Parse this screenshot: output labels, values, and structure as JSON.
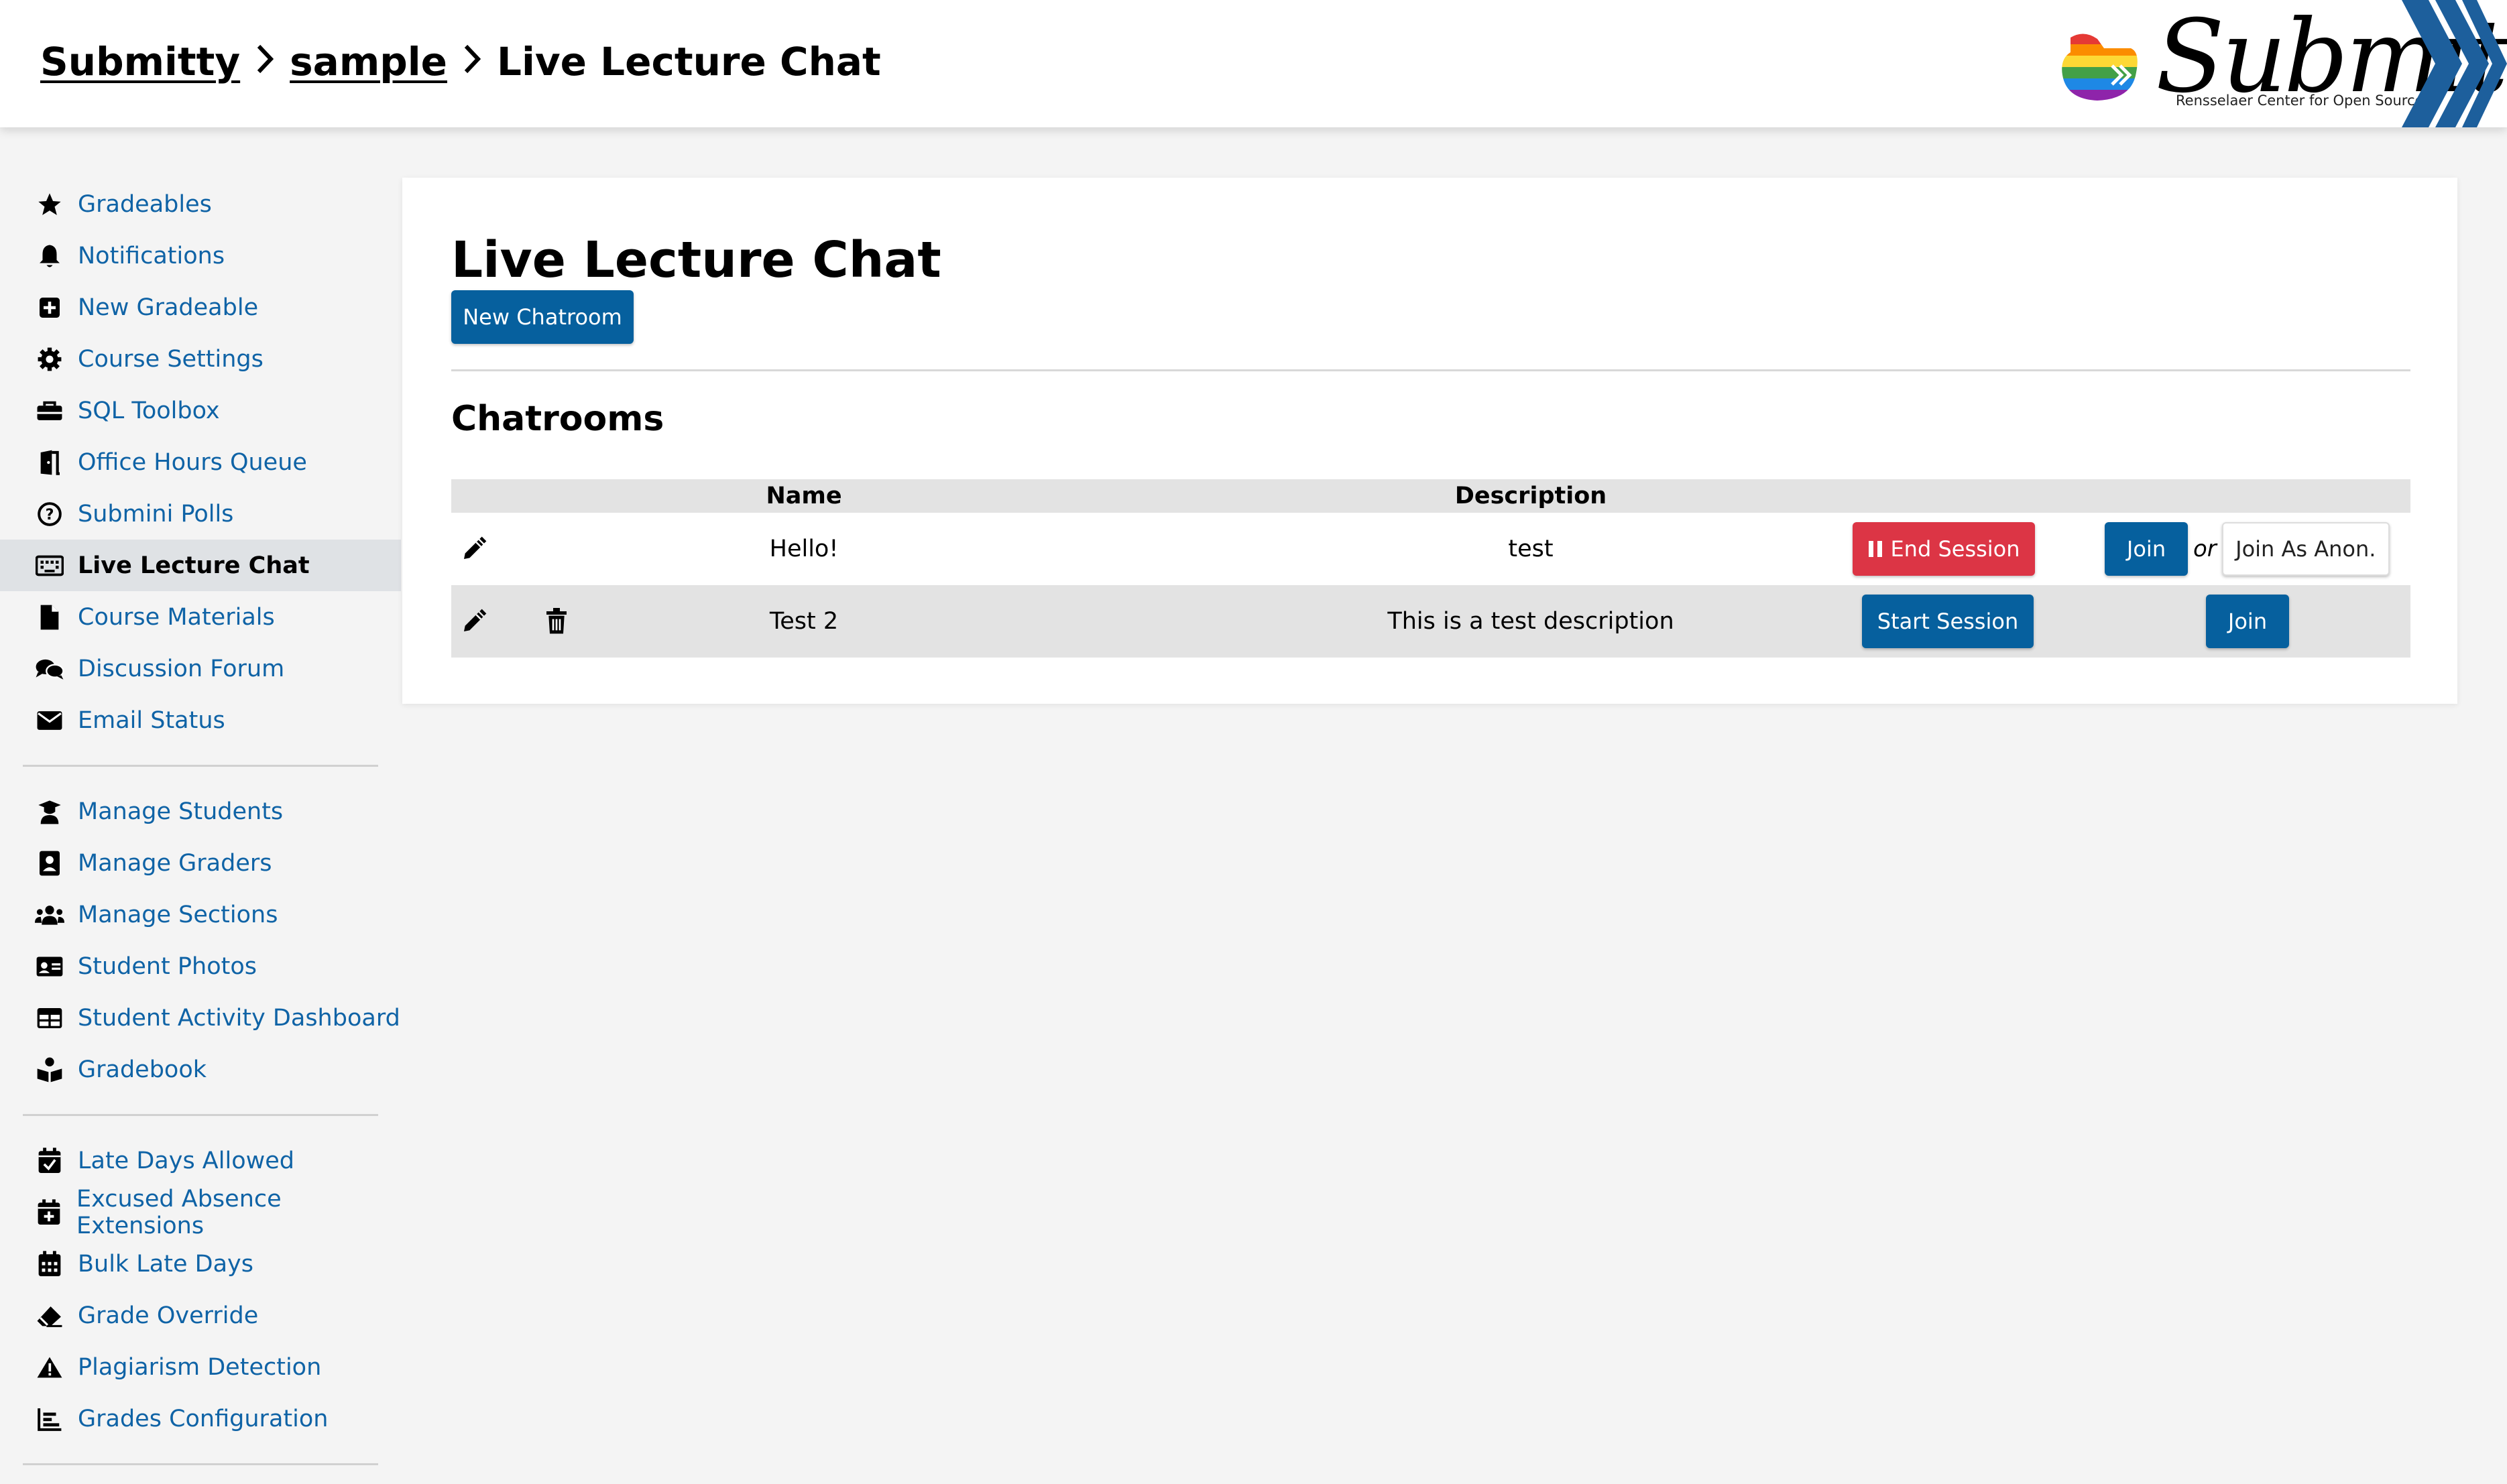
{
  "breadcrumb": {
    "home": "Submitty",
    "course": "sample",
    "current": "Live Lecture Chat"
  },
  "logo": {
    "text": "Submitty",
    "subtitle": "Rensselaer Center for Open Source"
  },
  "sidebar": {
    "groups": [
      [
        {
          "label": "Gradeables",
          "icon": "star-icon"
        },
        {
          "label": "Notifications",
          "icon": "bell-icon"
        },
        {
          "label": "New Gradeable",
          "icon": "plus-square-icon"
        },
        {
          "label": "Course Settings",
          "icon": "gear-icon"
        },
        {
          "label": "SQL Toolbox",
          "icon": "toolbox-icon"
        },
        {
          "label": "Office Hours Queue",
          "icon": "door-icon"
        },
        {
          "label": "Submini Polls",
          "icon": "question-circle-icon"
        },
        {
          "label": "Live Lecture Chat",
          "icon": "keyboard-icon",
          "active": true
        },
        {
          "label": "Course Materials",
          "icon": "file-icon"
        },
        {
          "label": "Discussion Forum",
          "icon": "comments-icon"
        },
        {
          "label": "Email Status",
          "icon": "envelope-icon"
        }
      ],
      [
        {
          "label": "Manage Students",
          "icon": "graduate-icon"
        },
        {
          "label": "Manage Graders",
          "icon": "id-badge-icon"
        },
        {
          "label": "Manage Sections",
          "icon": "users-icon"
        },
        {
          "label": "Student Photos",
          "icon": "id-card-icon"
        },
        {
          "label": "Student Activity Dashboard",
          "icon": "table-icon"
        },
        {
          "label": "Gradebook",
          "icon": "book-reader-icon"
        }
      ],
      [
        {
          "label": "Late Days Allowed",
          "icon": "calendar-check-icon"
        },
        {
          "label": "Excused Absence Extensions",
          "icon": "calendar-plus-icon"
        },
        {
          "label": "Bulk Late Days",
          "icon": "calendar-grid-icon"
        },
        {
          "label": "Grade Override",
          "icon": "eraser-icon"
        },
        {
          "label": "Plagiarism Detection",
          "icon": "warning-icon"
        },
        {
          "label": "Grades Configuration",
          "icon": "chart-icon"
        }
      ]
    ]
  },
  "main": {
    "title": "Live Lecture Chat",
    "new_chatroom_label": "New Chatroom",
    "section_title": "Chatrooms",
    "table": {
      "headers": {
        "name": "Name",
        "description": "Description"
      },
      "rows": [
        {
          "name": "Hello!",
          "description": "test",
          "session_label": "End Session",
          "session_active": true,
          "join_label": "Join",
          "or_label": "or",
          "anon_label": "Join As Anon."
        },
        {
          "name": "Test 2",
          "description": "This is a test description",
          "session_label": "Start Session",
          "session_active": false,
          "join_label": "Join"
        }
      ]
    }
  },
  "colors": {
    "link": "#0f63a6",
    "primary": "#06609e",
    "danger": "#dc3545",
    "active_bg": "#dfe2e5"
  }
}
